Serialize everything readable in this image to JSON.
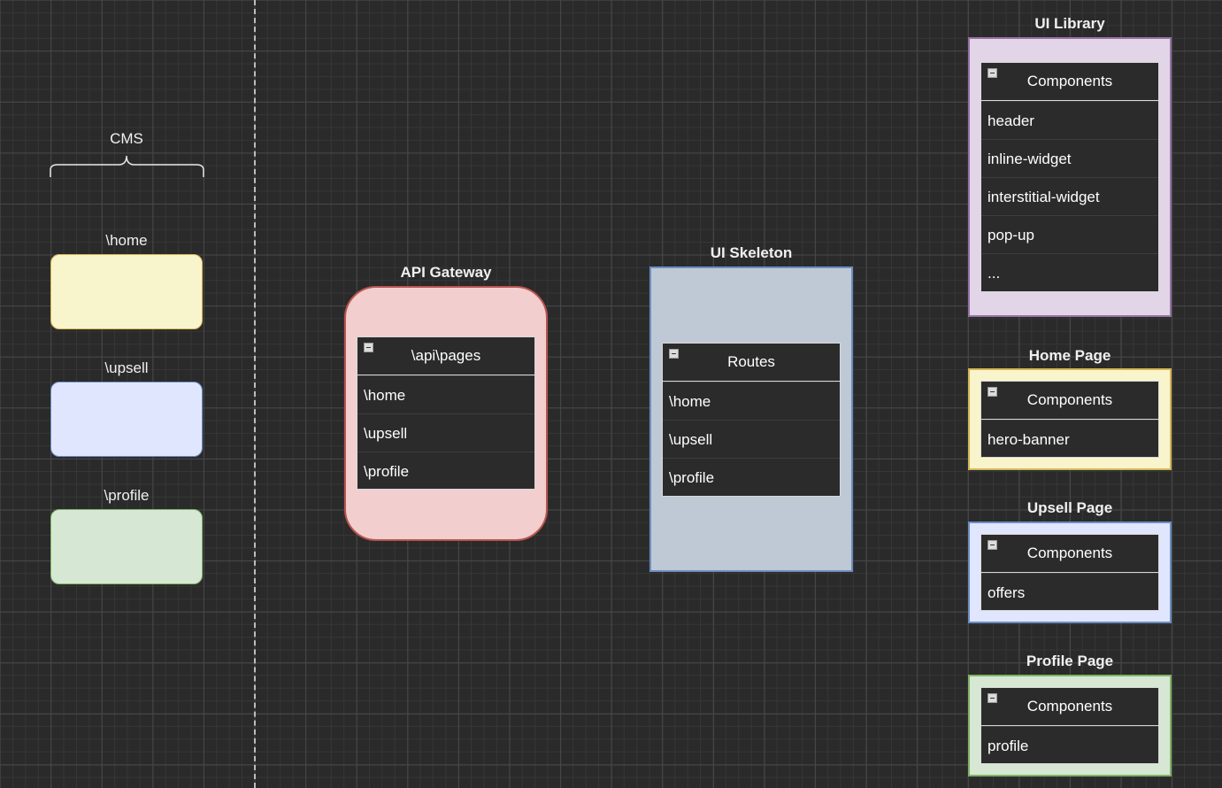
{
  "cms": {
    "title": "CMS",
    "pages": [
      {
        "label": "\\home",
        "color": "#f8f4cc"
      },
      {
        "label": "\\upsell",
        "color": "#e1e6ff"
      },
      {
        "label": "\\profile",
        "color": "#d6e8d4"
      }
    ]
  },
  "api_gateway": {
    "title": "API Gateway",
    "fill": "#f2cece",
    "border": "#b85450",
    "table": {
      "header": "\\api\\pages",
      "rows": [
        "\\home",
        "\\upsell",
        "\\profile"
      ]
    }
  },
  "ui_skeleton": {
    "title": "UI Skeleton",
    "fill": "#bfc9d5",
    "border": "#6c8ebf",
    "table": {
      "header": "Routes",
      "rows": [
        "\\home",
        "\\upsell",
        "\\profile"
      ]
    }
  },
  "ui_library": {
    "title": "UI Library",
    "fill": "#e1d5e7",
    "border": "#9673a6",
    "table": {
      "header": "Components",
      "rows": [
        "header",
        "inline-widget",
        "interstitial-widget",
        "pop-up",
        "..."
      ]
    }
  },
  "home_page": {
    "title": "Home Page",
    "fill": "#f8f4cc",
    "border": "#d6b656",
    "table": {
      "header": "Components",
      "rows": [
        "hero-banner"
      ]
    }
  },
  "upsell_page": {
    "title": "Upsell Page",
    "fill": "#e1e6ff",
    "border": "#6c8ebf",
    "table": {
      "header": "Components",
      "rows": [
        "offers"
      ]
    }
  },
  "profile_page": {
    "title": "Profile Page",
    "fill": "#d6e8d4",
    "border": "#82b366",
    "table": {
      "header": "Components",
      "rows": [
        "profile"
      ]
    }
  }
}
